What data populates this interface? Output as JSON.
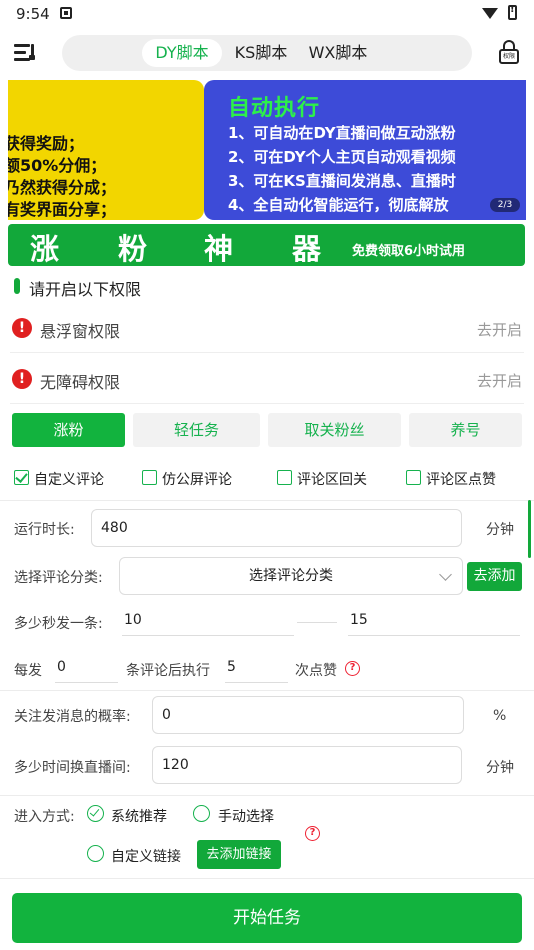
{
  "status": {
    "time": "9:54"
  },
  "tabs": [
    {
      "label": "DY脚本"
    },
    {
      "label": "KS脚本"
    },
    {
      "label": "WX脚本"
    }
  ],
  "lock_badge": "权限",
  "banner": {
    "left_lines": [
      "获得奖励；",
      "额50%分佣；",
      "乃然获得分成；",
      "有奖界面分享；"
    ],
    "title": "自动执行",
    "lines": [
      "1、可自动在DY直播间做互动涨粉",
      "2、可在DY个人主页自动观看视频",
      "3、可在KS直播间发消息、直播时",
      "4、全自动化智能运行，彻底解放"
    ],
    "indicator": "2/3"
  },
  "grow_banner": {
    "chars": [
      "涨",
      "粉",
      "神",
      "器"
    ],
    "note": "免费领取6小时试用"
  },
  "permissions": {
    "heading": "请开启以下权限",
    "items": [
      {
        "label": "悬浮窗权限",
        "action": "去开启"
      },
      {
        "label": "无障碍权限",
        "action": "去开启"
      }
    ]
  },
  "modes": [
    "涨粉",
    "轻任务",
    "取关粉丝",
    "养号"
  ],
  "options": [
    {
      "label": "自定义评论",
      "checked": true
    },
    {
      "label": "仿公屏评论",
      "checked": false
    },
    {
      "label": "评论区回关",
      "checked": false
    },
    {
      "label": "评论区点赞",
      "checked": false
    }
  ],
  "form": {
    "runtime_label": "运行时长:",
    "runtime_value": "480",
    "runtime_unit": "分钟",
    "category_label": "选择评论分类:",
    "category_value": "选择评论分类",
    "add_button": "去添加",
    "interval_label": "多少秒发一条:",
    "interval_min": "10",
    "interval_max": "15",
    "every_label": "每发",
    "every_value": "0",
    "after_label": "条评论后执行",
    "like_value": "5",
    "like_label": "次点赞",
    "follow_prob_label": "关注发消息的概率:",
    "follow_prob_value": "0",
    "follow_prob_unit": "%",
    "switch_room_label": "多少时间换直播间:",
    "switch_room_value": "120",
    "switch_room_unit": "分钟",
    "entry_label": "进入方式:",
    "entry_options": [
      {
        "label": "系统推荐",
        "checked": true
      },
      {
        "label": "手动选择",
        "checked": false
      },
      {
        "label": "自定义链接",
        "checked": false
      }
    ],
    "add_link_button": "去添加链接"
  },
  "start_button": "开始任务"
}
